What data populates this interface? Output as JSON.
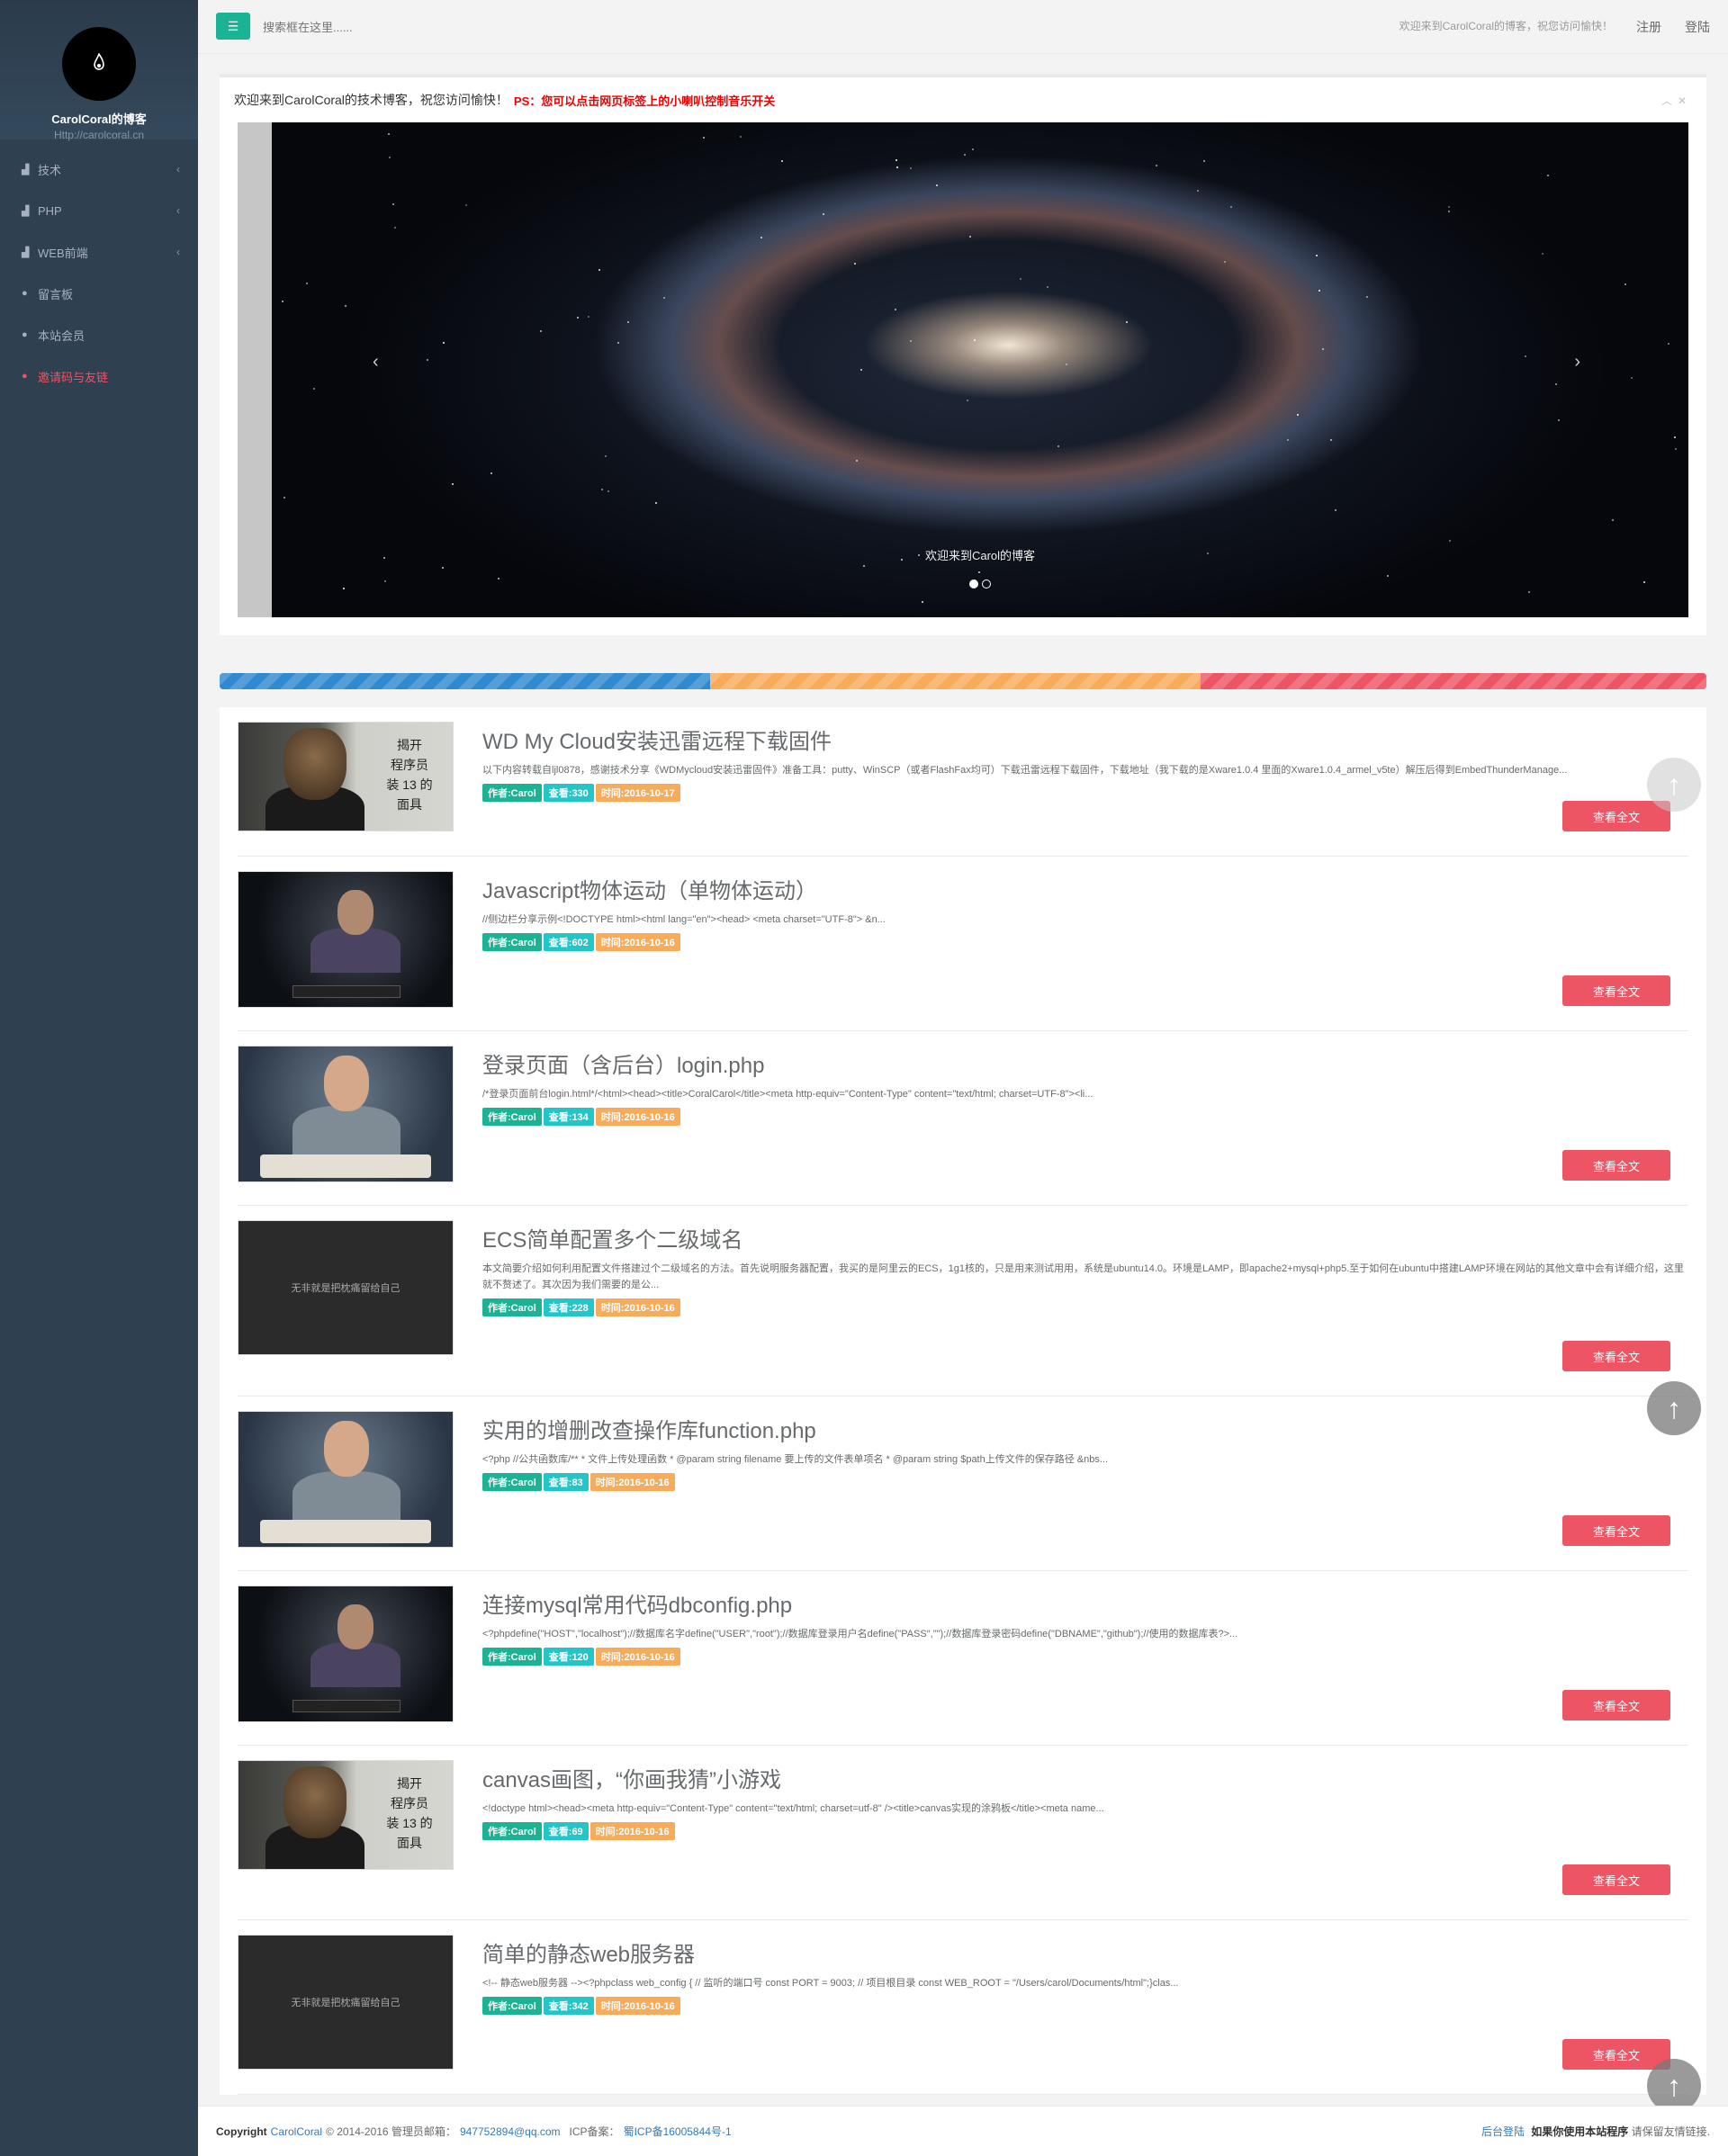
{
  "sidebar": {
    "site_name": "CarolCoral的博客",
    "site_url": "Http://carolcoral.cn",
    "avatar_icon": "flame-icon",
    "items": [
      {
        "label": "技术",
        "icon": "bar-chart-icon",
        "has_chevron": true
      },
      {
        "label": "PHP",
        "icon": "bar-chart-icon",
        "has_chevron": true
      },
      {
        "label": "WEB前端",
        "icon": "bar-chart-icon",
        "has_chevron": true
      },
      {
        "label": "留言板",
        "icon": "globe-icon",
        "has_chevron": false
      },
      {
        "label": "本站会员",
        "icon": "globe-icon",
        "has_chevron": false
      },
      {
        "label": "邀请码与友链",
        "icon": "globe-icon",
        "has_chevron": false,
        "color": "#ed5565"
      }
    ]
  },
  "topbar": {
    "search_placeholder": "搜索框在这里......",
    "welcome": "欢迎来到CarolCoral的博客，祝您访问愉快！",
    "register": "注册",
    "login": "登陆"
  },
  "notice": {
    "text": "欢迎来到CarolCoral的技术博客，祝您访问愉快！",
    "ps": "PS：您可以点击网页标签上的小喇叭控制音乐开关"
  },
  "carousel": {
    "caption": "欢迎来到Carol的博客",
    "prev": "‹",
    "next": "›",
    "slide_count": 2,
    "active_slide": 1
  },
  "progress_segments": [
    {
      "color": "#2f8ad0",
      "fraction": 0.33
    },
    {
      "color": "#f8ac59",
      "fraction": 0.33
    },
    {
      "color": "#ed5565",
      "fraction": 0.34
    }
  ],
  "posts": [
    {
      "thumb": "monkey",
      "thumb_text": "揭开\n程序员\n装 13 的\n面具",
      "title": "WD My Cloud安装迅雷远程下载固件",
      "desc": "以下内容转载自ljl0878，感谢技术分享《WDMycloud安装迅雷固件》准备工具：putty、WinSCP（或者FlashFax均可）下载迅雷远程下载固件，下载地址（我下载的是Xware1.0.4 里面的Xware1.0.4_armel_v5te）解压后得到EmbedThunderManage...",
      "author": "作者:Carol",
      "views": "查看:330",
      "time": "时间:2016-10-17"
    },
    {
      "thumb": "coder",
      "thumb_text": "",
      "title": "Javascript物体运动（单物体运动）",
      "desc": "//侧边栏分享示例<!DOCTYPE html><html lang=\"en\"><head>      <meta charset=\"UTF-8\">   &n...",
      "author": "作者:Carol",
      "views": "查看:602",
      "time": "时间:2016-10-16"
    },
    {
      "thumb": "boy",
      "thumb_text": "",
      "title": "登录页面（含后台）login.php",
      "desc": "/*登录页面前台login.html*/<html><head><title>CoralCarol</title><meta http-equiv=\"Content-Type\" content=\"text/html; charset=UTF-8\"><li...",
      "author": "作者:Carol",
      "views": "查看:134",
      "time": "时间:2016-10-16"
    },
    {
      "thumb": "dark",
      "thumb_text": "无非就是把枕痛留给自己",
      "title": "ECS简单配置多个二级域名",
      "desc": "本文简要介绍如何利用配置文件搭建过个二级域名的方法。首先说明服务器配置，我买的是阿里云的ECS，1g1核的，只是用来测试用用，系统是ubuntu14.0。环境是LAMP，即apache2+mysql+php5.至于如何在ubuntu中搭建LAMP环境在网站的其他文章中会有详细介绍，这里就不赘述了。其次因为我们需要的是公...",
      "author": "作者:Carol",
      "views": "查看:228",
      "time": "时间:2016-10-16"
    },
    {
      "thumb": "boy",
      "thumb_text": "",
      "title": "实用的增删改查操作库function.php",
      "desc": "<?php //公共函数库/** * 文件上传处理函数 * @param string filename 要上传的文件表单项名 * @param string $path上传文件的保存路径 &nbs...",
      "author": "作者:Carol",
      "views": "查看:83",
      "time": "时间:2016-10-16"
    },
    {
      "thumb": "coder",
      "thumb_text": "",
      "title": "连接mysql常用代码dbconfig.php",
      "desc": "<?phpdefine(\"HOST\",\"localhost\");//数据库名字define(\"USER\",\"root\");//数据库登录用户名define(\"PASS\",\"\");//数据库登录密码define(\"DBNAME\",\"github\");//使用的数据库表?>...",
      "author": "作者:Carol",
      "views": "查看:120",
      "time": "时间:2016-10-16"
    },
    {
      "thumb": "monkey",
      "thumb_text": "揭开\n程序员\n装 13 的\n面具",
      "title": "canvas画图，“你画我猜”小游戏",
      "desc": "<!doctype html><head><meta http-equiv=\"Content-Type\" content=\"text/html; charset=utf-8\" /><title>canvas实现的涂鸦板</title><meta name...",
      "author": "作者:Carol",
      "views": "查看:69",
      "time": "时间:2016-10-16"
    },
    {
      "thumb": "dark",
      "thumb_text": "无非就是把枕痛留给自己",
      "title": "简单的静态web服务器",
      "desc": "<!-- 静态web服务器 --><?phpclass web_config { // 监听的端口号 const PORT = 9003; // 项目根目录 const WEB_ROOT = \"/Users/carol/Documents/html\";}clas...",
      "author": "作者:Carol",
      "views": "查看:342",
      "time": "时间:2016-10-16"
    }
  ],
  "read_more_label": "查看全文",
  "back_to_top": "↑",
  "footer": {
    "copyright": "Copyright",
    "brand": "CarolCoral",
    "years": "© 2014-2016 管理员邮箱：",
    "email": "947752894@qq.com",
    "icp_label": "ICP备案：",
    "icp": "蜀ICP备16005844号-1",
    "admin_login": "后台登陆",
    "notice_bold": "如果你使用本站程序",
    "notice_rest": "请保留友情链接."
  }
}
